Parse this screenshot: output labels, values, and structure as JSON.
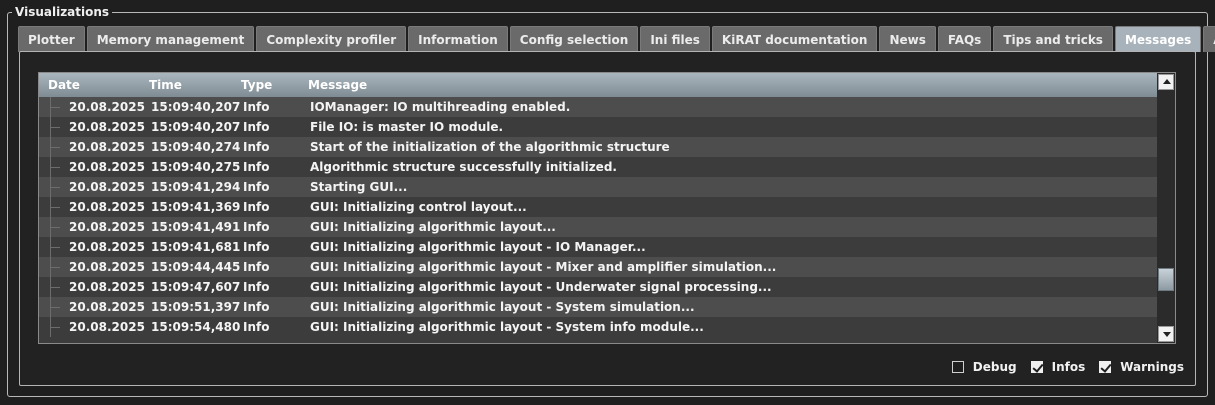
{
  "group_title": "Visualizations",
  "tabs": [
    {
      "label": "Plotter",
      "active": false
    },
    {
      "label": "Memory management",
      "active": false
    },
    {
      "label": "Complexity profiler",
      "active": false
    },
    {
      "label": "Information",
      "active": false
    },
    {
      "label": "Config selection",
      "active": false
    },
    {
      "label": "Ini files",
      "active": false
    },
    {
      "label": "KiRAT documentation",
      "active": false
    },
    {
      "label": "News",
      "active": false
    },
    {
      "label": "FAQs",
      "active": false
    },
    {
      "label": "Tips and tricks",
      "active": false
    },
    {
      "label": "Messages",
      "active": true
    },
    {
      "label": "About",
      "active": false
    }
  ],
  "table": {
    "columns": {
      "date": "Date",
      "time": "Time",
      "type": "Type",
      "message": "Message"
    },
    "rows": [
      {
        "date": "20.08.2025",
        "time": "15:09:40,207",
        "type": "Info",
        "message": "IOManager: IO multihreading enabled."
      },
      {
        "date": "20.08.2025",
        "time": "15:09:40,207",
        "type": "Info",
        "message": "File IO: is master IO module."
      },
      {
        "date": "20.08.2025",
        "time": "15:09:40,274",
        "type": "Info",
        "message": "Start of the initialization of the algorithmic structure"
      },
      {
        "date": "20.08.2025",
        "time": "15:09:40,275",
        "type": "Info",
        "message": "Algorithmic structure successfully initialized."
      },
      {
        "date": "20.08.2025",
        "time": "15:09:41,294",
        "type": "Info",
        "message": "Starting GUI..."
      },
      {
        "date": "20.08.2025",
        "time": "15:09:41,369",
        "type": "Info",
        "message": "GUI: Initializing control layout..."
      },
      {
        "date": "20.08.2025",
        "time": "15:09:41,491",
        "type": "Info",
        "message": "GUI: Initializing algorithmic layout..."
      },
      {
        "date": "20.08.2025",
        "time": "15:09:41,681",
        "type": "Info",
        "message": "GUI: Initializing algorithmic layout - IO Manager..."
      },
      {
        "date": "20.08.2025",
        "time": "15:09:44,445",
        "type": "Info",
        "message": "GUI: Initializing algorithmic layout - Mixer and amplifier simulation..."
      },
      {
        "date": "20.08.2025",
        "time": "15:09:47,607",
        "type": "Info",
        "message": "GUI: Initializing algorithmic layout - Underwater signal processing..."
      },
      {
        "date": "20.08.2025",
        "time": "15:09:51,397",
        "type": "Info",
        "message": "GUI: Initializing algorithmic layout - System simulation..."
      },
      {
        "date": "20.08.2025",
        "time": "15:09:54,480",
        "type": "Info",
        "message": "GUI: Initializing algorithmic layout - System info module..."
      }
    ]
  },
  "scrollbar": {
    "up_icon": "triangle-up-icon",
    "down_icon": "triangle-down-icon"
  },
  "filters": [
    {
      "label": "Debug",
      "checked": false
    },
    {
      "label": "Infos",
      "checked": true
    },
    {
      "label": "Warnings",
      "checked": true
    }
  ]
}
